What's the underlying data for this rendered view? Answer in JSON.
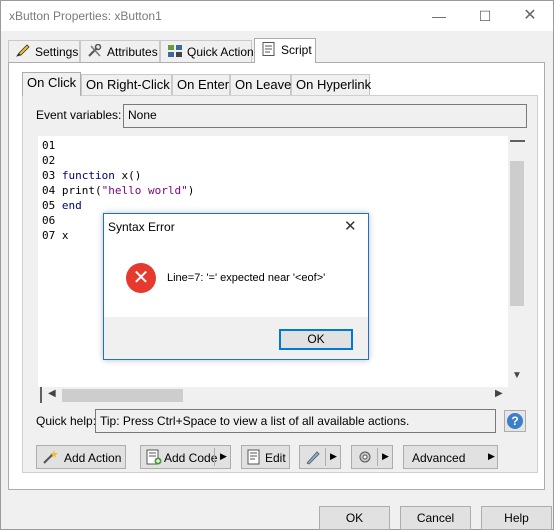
{
  "window": {
    "title": "xButton Properties: xButton1",
    "minimize_glyph": "—",
    "maximize_glyph": "☐",
    "close_glyph": "✕"
  },
  "outer_tabs": [
    {
      "label": "Settings",
      "icon": "pencil-icon"
    },
    {
      "label": "Attributes",
      "icon": "tools-icon"
    },
    {
      "label": "Quick Action",
      "icon": "quick-action-icon"
    },
    {
      "label": "Script",
      "icon": "script-icon"
    }
  ],
  "inner_tabs": [
    {
      "label": "On Click"
    },
    {
      "label": "On Right-Click"
    },
    {
      "label": "On Enter"
    },
    {
      "label": "On Leave"
    },
    {
      "label": "On Hyperlink"
    }
  ],
  "event_variables": {
    "label": "Event variables:",
    "value": "None"
  },
  "code_lines": [
    {
      "num": "01",
      "text": ""
    },
    {
      "num": "02",
      "text": ""
    },
    {
      "num": "03",
      "kw": "function",
      "rest": " x()"
    },
    {
      "num": "04",
      "pre": "print(",
      "str": "\"hello world\"",
      "post": ")"
    },
    {
      "num": "05",
      "kw": "end"
    },
    {
      "num": "06",
      "text": ""
    },
    {
      "num": "07",
      "text": " x"
    }
  ],
  "quick_help": {
    "label": "Quick help:",
    "text": "Tip: Press Ctrl+Space to view a list of all available actions.",
    "help_glyph": "?"
  },
  "toolbar": {
    "add_action": "Add Action",
    "add_code": "Add Code",
    "edit": "Edit",
    "advanced": "Advanced"
  },
  "footer": {
    "ok": "OK",
    "cancel": "Cancel",
    "help": "Help"
  },
  "dialog": {
    "title": "Syntax Error",
    "message": "Line=7: '=' expected near '<eof>'",
    "ok": "OK",
    "close_glyph": "✕",
    "icon_glyph": "✕"
  }
}
